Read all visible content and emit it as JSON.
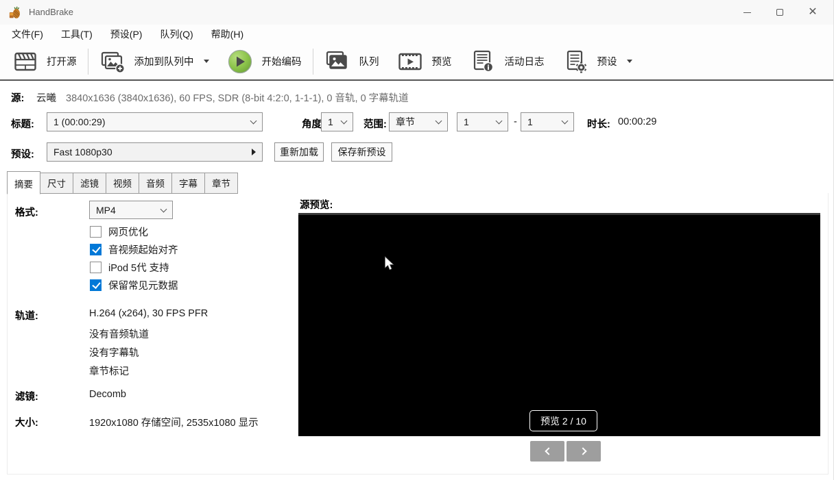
{
  "window": {
    "title": "HandBrake"
  },
  "menu": {
    "items": [
      {
        "label": "文件(F)"
      },
      {
        "label": "工具(T)"
      },
      {
        "label": "预设(P)"
      },
      {
        "label": "队列(Q)"
      },
      {
        "label": "帮助(H)"
      }
    ]
  },
  "toolbar": {
    "open_source": "打开源",
    "add_to_queue": "添加到队列中",
    "start_encode": "开始编码",
    "queue": "队列",
    "preview": "预览",
    "activity_log": "活动日志",
    "presets": "预设"
  },
  "source_row": {
    "label": "源:",
    "name": "云曦",
    "details": "3840x1636 (3840x1636), 60 FPS, SDR (8-bit 4:2:0, 1-1-1), 0 音轨, 0 字幕轨道"
  },
  "title_row": {
    "label": "标题:",
    "title_value": "1 (00:00:29)",
    "angle_label": "角度",
    "angle_value": "1",
    "range_label": "范围:",
    "range_type": "章节",
    "range_start": "1",
    "range_sep": "-",
    "range_end": "1",
    "duration_label": "时长:",
    "duration_value": "00:00:29"
  },
  "preset_row": {
    "label": "预设:",
    "value": "Fast 1080p30",
    "reload": "重新加载",
    "save_new": "保存新预设"
  },
  "tabs": [
    {
      "label": "摘要",
      "active": true
    },
    {
      "label": "尺寸",
      "active": false
    },
    {
      "label": "滤镜",
      "active": false
    },
    {
      "label": "视频",
      "active": false
    },
    {
      "label": "音频",
      "active": false
    },
    {
      "label": "字幕",
      "active": false
    },
    {
      "label": "章节",
      "active": false
    }
  ],
  "summary": {
    "format_label": "格式:",
    "format_value": "MP4",
    "checkboxes": [
      {
        "label": "网页优化",
        "checked": false
      },
      {
        "label": "音视频起始对齐",
        "checked": true
      },
      {
        "label": "iPod 5代 支持",
        "checked": false
      },
      {
        "label": "保留常见元数据",
        "checked": true
      }
    ],
    "tracks_label": "轨道:",
    "tracks": [
      "H.264 (x264), 30 FPS PFR",
      "没有音频轨道",
      "没有字幕轨",
      "章节标记"
    ],
    "filters_label": "滤镜:",
    "filters_value": "Decomb",
    "size_label": "大小:",
    "size_value": "1920x1080 存储空间, 2535x1080 显示"
  },
  "preview_panel": {
    "label": "源预览:",
    "overlay": "预览 2 / 10"
  },
  "colors": {
    "accent_green": "#7cb342",
    "checkbox_blue": "#0078d7",
    "toolbar_icon": "#4a4a4a",
    "preview_bg": "#000000",
    "nav_button_gray": "#9e9e9e"
  }
}
